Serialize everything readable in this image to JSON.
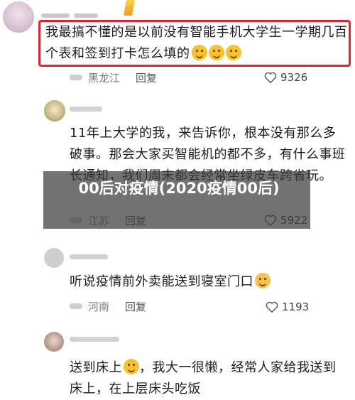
{
  "comments": [
    {
      "text": "我最搞不懂的是以前没有智能手机大学生一学期几百个表和签到打卡怎么填的",
      "location": "黑龙江",
      "reply_label": "回复",
      "likes": "9326"
    },
    {
      "text": "11年上大学的我，来告诉你，根本没有那么多破事。那会大家买智能机的都不多，有什么事班长通知，我们周末都会经常坐绿皮车跨省玩。",
      "location": "江苏",
      "reply_label": "回复",
      "likes": "5922"
    },
    {
      "text": "听说疫情前外卖能送到寝室门口",
      "location": "河南",
      "reply_label": "回复",
      "likes": "1193"
    },
    {
      "text_a": "送到床上",
      "text_b": "，我大一很懒，经常人家给我送到床上，在上层床头吃饭"
    }
  ],
  "overlay_title": "00后对疫情(2020疫情00后)",
  "colors": {
    "highlight": "#e0262a",
    "overlay": "#3c3c3c"
  }
}
